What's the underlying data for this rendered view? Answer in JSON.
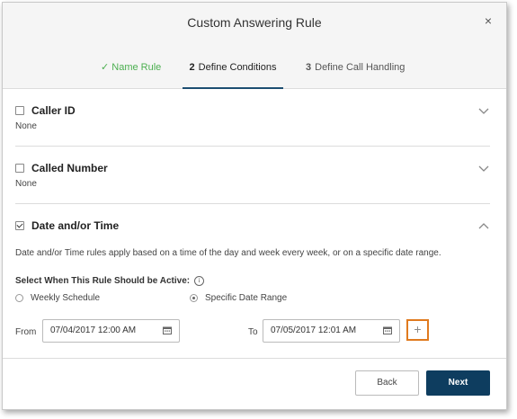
{
  "dialog": {
    "title": "Custom Answering Rule",
    "close_glyph": "×"
  },
  "steps": [
    {
      "number": "✓",
      "label": "Name Rule",
      "state": "done"
    },
    {
      "number": "2",
      "label": "Define Conditions",
      "state": "active"
    },
    {
      "number": "3",
      "label": "Define Call Handling",
      "state": "pending"
    }
  ],
  "sections": {
    "caller_id": {
      "title": "Caller ID",
      "value": "None",
      "checked": false
    },
    "called_number": {
      "title": "Called Number",
      "value": "None",
      "checked": false
    },
    "date_time": {
      "title": "Date and/or Time",
      "checked": true,
      "description": "Date and/or Time rules apply based on a time of the day and week every week, or on a specific date range.",
      "active_label": "Select When This Rule Should be Active:",
      "info_glyph": "i",
      "options": {
        "weekly": "Weekly Schedule",
        "specific": "Specific Date Range"
      },
      "selected_option": "Specific Date Range",
      "from_label": "From",
      "from_value": "07/04/2017 12:00 AM",
      "to_label": "To",
      "to_value": "07/05/2017 12:01 AM",
      "add_glyph": "+"
    }
  },
  "footer": {
    "back_label": "Back",
    "next_label": "Next"
  },
  "colors": {
    "primary": "#0e3d5f",
    "done_step": "#4caf50",
    "highlight": "#e07a1f"
  }
}
